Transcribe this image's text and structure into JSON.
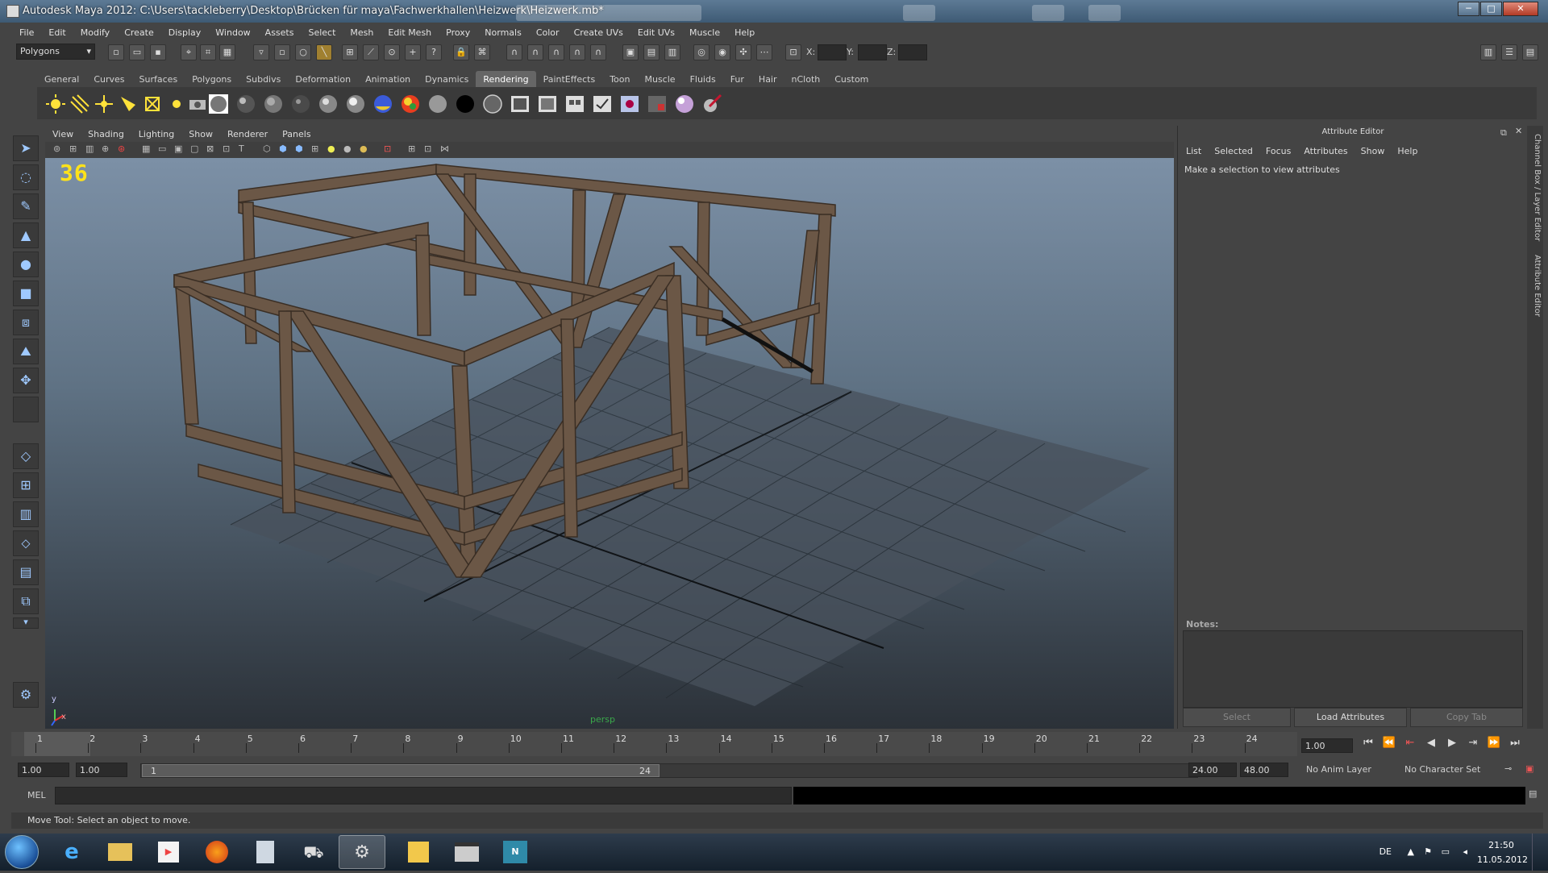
{
  "window": {
    "title": "Autodesk Maya 2012: C:\\Users\\tackleberry\\Desktop\\Brücken für maya\\Fachwerkhallen\\Heizwerk\\Heizwerk.mb*",
    "min": "─",
    "max": "□",
    "close": "✕"
  },
  "menu": [
    "File",
    "Edit",
    "Modify",
    "Create",
    "Display",
    "Window",
    "Assets",
    "Select",
    "Mesh",
    "Edit Mesh",
    "Proxy",
    "Normals",
    "Color",
    "Create UVs",
    "Edit UVs",
    "Muscle",
    "Help"
  ],
  "statusline": {
    "mode": "Polygons",
    "x_label": "X:",
    "y_label": "Y:",
    "z_label": "Z:"
  },
  "shelf": {
    "tabs": [
      "General",
      "Curves",
      "Surfaces",
      "Polygons",
      "Subdivs",
      "Deformation",
      "Animation",
      "Dynamics",
      "Rendering",
      "PaintEffects",
      "Toon",
      "Muscle",
      "Fluids",
      "Fur",
      "Hair",
      "nCloth",
      "Custom"
    ],
    "active": "Rendering"
  },
  "viewport": {
    "menu": [
      "View",
      "Shading",
      "Lighting",
      "Show",
      "Renderer",
      "Panels"
    ],
    "frame_counter": "36",
    "camera": "persp",
    "axis_y": "y",
    "axis_x": "x"
  },
  "attribute_editor": {
    "title": "Attribute Editor",
    "menu": [
      "List",
      "Selected",
      "Focus",
      "Attributes",
      "Show",
      "Help"
    ],
    "hint": "Make a selection to view attributes",
    "notes_label": "Notes:",
    "buttons": {
      "select": "Select",
      "load": "Load Attributes",
      "copy": "Copy Tab"
    },
    "side_tabs": [
      "Channel Box / Layer Editor",
      "Attribute Editor"
    ]
  },
  "timeslider": {
    "ticks": [
      "1",
      "2",
      "3",
      "4",
      "5",
      "6",
      "7",
      "8",
      "9",
      "10",
      "11",
      "12",
      "13",
      "14",
      "15",
      "16",
      "17",
      "18",
      "19",
      "20",
      "21",
      "22",
      "23",
      "24"
    ],
    "current": "1.00"
  },
  "range": {
    "start": "1.00",
    "anim_start": "1.00",
    "slider_start": "1",
    "slider_end": "24",
    "anim_end": "24.00",
    "end": "48.00",
    "anim_layer": "No Anim Layer",
    "char_set": "No Character Set"
  },
  "cmdline": {
    "label": "MEL"
  },
  "helpline": "Move Tool: Select an object to move.",
  "taskbar": {
    "lang": "DE",
    "time": "21:50",
    "date": "11.05.2012"
  },
  "colors": {
    "frame_counter": "#ffe21a",
    "active_tab": "#666666"
  }
}
